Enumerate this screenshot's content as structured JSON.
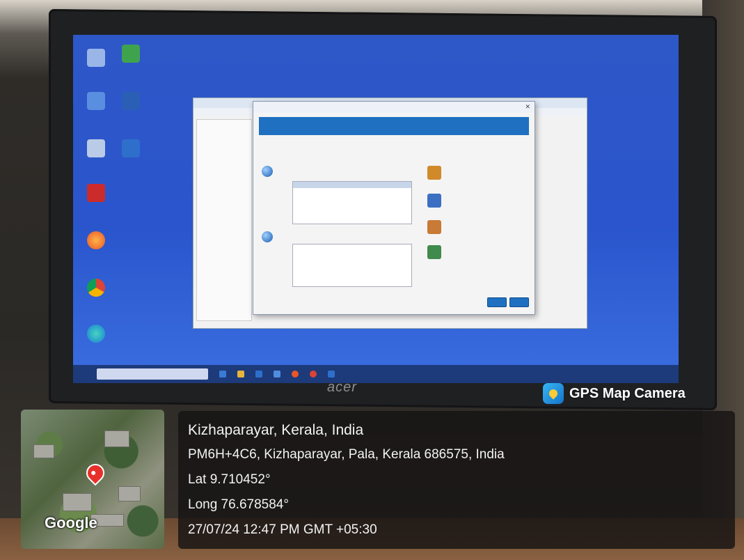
{
  "overlay": {
    "app_name": "GPS Map Camera",
    "map_brand": "Google",
    "place": "Kizhaparayar, Kerala, India",
    "address": "PM6H+4C6, Kizhaparayar, Pala, Kerala 686575, India",
    "lat": "Lat 9.710452°",
    "long": "Long 76.678584°",
    "datetime": "27/07/24 12:47 PM GMT +05:30"
  },
  "monitor": {
    "brand": "acer"
  },
  "colors": {
    "desktop_blue": "#2a55cc",
    "dialog_banner": "#1f70c1",
    "overlay_bg": "#161414",
    "map_pin": "#e8302b"
  }
}
